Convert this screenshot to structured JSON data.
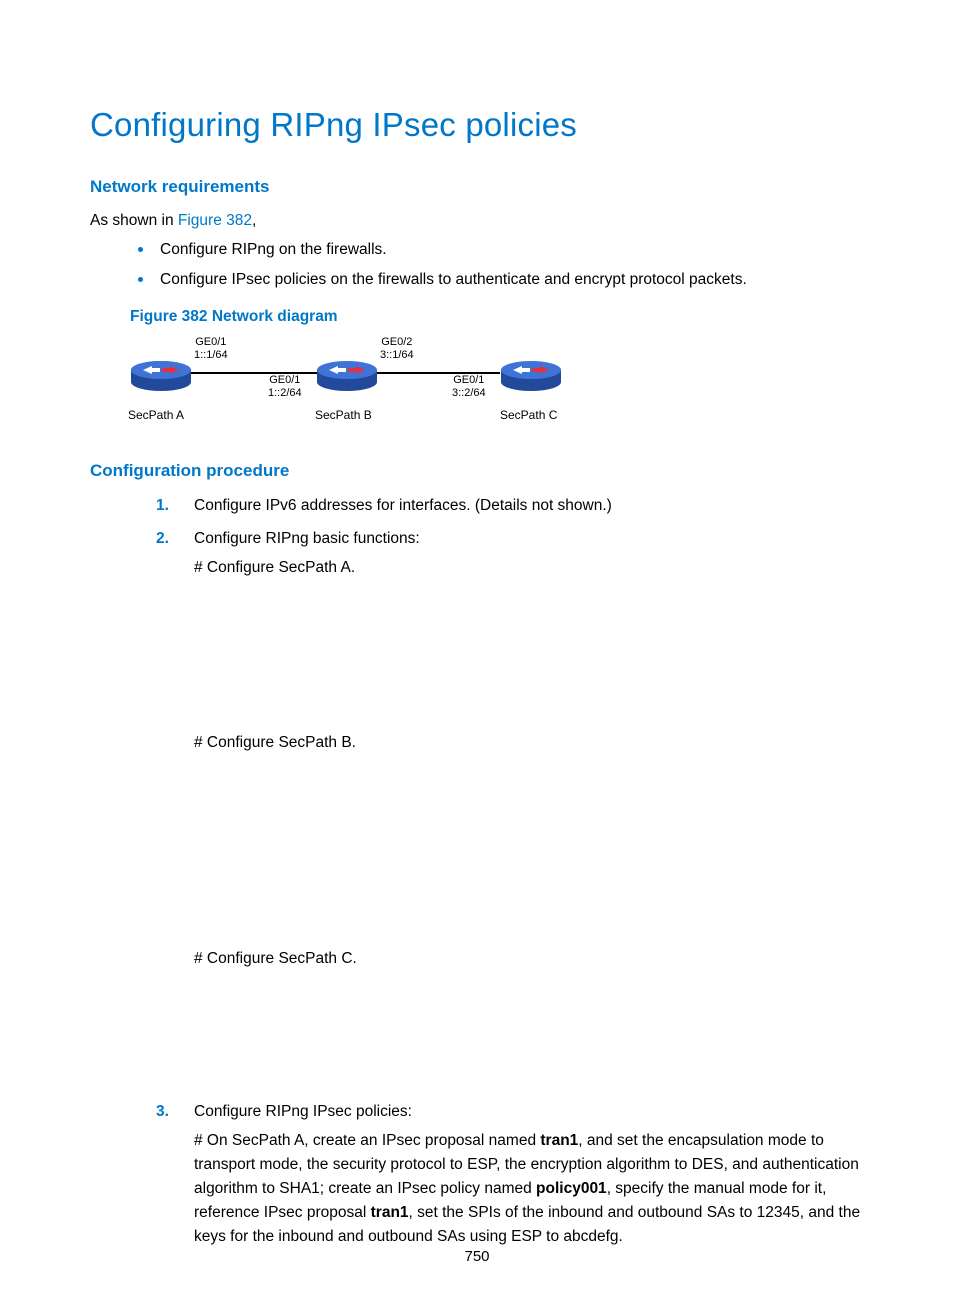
{
  "page": {
    "title": "Configuring RIPng IPsec policies",
    "footerPageNumber": "750"
  },
  "sections": {
    "networkReq": {
      "heading": "Network requirements",
      "intro_prefix": "As shown in ",
      "intro_link": "Figure 382",
      "intro_suffix": ",",
      "bullets": [
        "Configure RIPng on the firewalls.",
        "Configure IPsec policies on the firewalls to authenticate and encrypt protocol packets."
      ],
      "figureCaption": "Figure 382 Network diagram"
    },
    "diagram": {
      "devices": {
        "a": {
          "label": "SecPath A"
        },
        "b": {
          "label": "SecPath B"
        },
        "c": {
          "label": "SecPath C"
        }
      },
      "ifaces": {
        "a_right": {
          "name": "GE0/1",
          "addr": "1::1/64"
        },
        "b_left": {
          "name": "GE0/1",
          "addr": "1::2/64"
        },
        "b_right": {
          "name": "GE0/2",
          "addr": "3::1/64"
        },
        "c_left": {
          "name": "GE0/1",
          "addr": "3::2/64"
        }
      }
    },
    "cfgProc": {
      "heading": "Configuration procedure",
      "step1": "Configure IPv6 addresses for interfaces. (Details not shown.)",
      "step2": {
        "title": "Configure RIPng basic functions:",
        "a": "# Configure SecPath A.",
        "b": "# Configure SecPath B.",
        "c": "# Configure SecPath C."
      },
      "step3": {
        "title": "Configure RIPng IPsec policies:",
        "para_pre": "# On SecPath A, create an IPsec proposal named ",
        "bold1": "tran1",
        "para_mid1": ", and set the encapsulation mode to transport mode, the security protocol to ESP, the encryption algorithm to DES, and authentication algorithm to SHA1; create an IPsec policy named ",
        "bold2": "policy001",
        "para_mid2": ", specify the manual mode for it, reference IPsec proposal ",
        "bold3": "tran1",
        "para_tail": ", set the SPIs of the inbound and outbound SAs to 12345, and the keys for the inbound and outbound SAs using ESP to abcdefg."
      }
    }
  }
}
